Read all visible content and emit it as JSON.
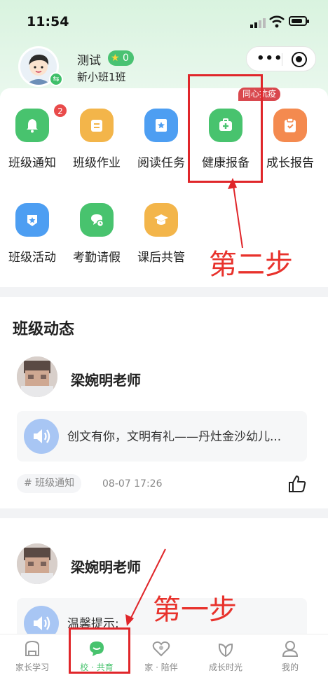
{
  "status_bar": {
    "time": "11:54"
  },
  "profile": {
    "name": "测试",
    "stars": "0",
    "class_name": "新小班1班"
  },
  "features": [
    {
      "label": "班级通知",
      "icon": "bell-icon",
      "color": "#48c36e",
      "badge": "2"
    },
    {
      "label": "班级作业",
      "icon": "homework-icon",
      "color": "#f3b54a"
    },
    {
      "label": "阅读任务",
      "icon": "book-icon",
      "color": "#4d9ef2"
    },
    {
      "label": "健康报备",
      "icon": "medical-kit-icon",
      "color": "#48c36e",
      "tag": "同心抗疫"
    },
    {
      "label": "成长报告",
      "icon": "clipboard-icon",
      "color": "#f48a4f"
    },
    {
      "label": "班级活动",
      "icon": "activity-icon",
      "color": "#4d9ef2"
    },
    {
      "label": "考勤请假",
      "icon": "chat-clock-icon",
      "color": "#48c36e"
    },
    {
      "label": "课后共管",
      "icon": "graduation-cap-icon",
      "color": "#f3b54a"
    }
  ],
  "annotations": {
    "step2": "第二步",
    "step1": "第一步"
  },
  "feed": {
    "title": "班级动态",
    "posts": [
      {
        "teacher": "梁婉明老师",
        "audio_text": "创文有你，文明有礼——丹灶金沙幼儿...",
        "topic": "# 班级通知",
        "time": "08-07 17:26"
      },
      {
        "teacher": "梁婉明老师",
        "audio_text": "温馨提示:"
      }
    ]
  },
  "tabbar": [
    {
      "label": "家长学习",
      "icon": "school-bag-icon",
      "active": false
    },
    {
      "label": "校 · 共育",
      "icon": "chat-bubble-icon",
      "active": true
    },
    {
      "label": "家 · 陪伴",
      "icon": "heart-icon",
      "active": false
    },
    {
      "label": "成长时光",
      "icon": "leaf-icon",
      "active": false
    },
    {
      "label": "我的",
      "icon": "person-icon",
      "active": false
    }
  ],
  "colors": {
    "accent": "#3fbf6a",
    "annotation_red": "#e0262a"
  }
}
